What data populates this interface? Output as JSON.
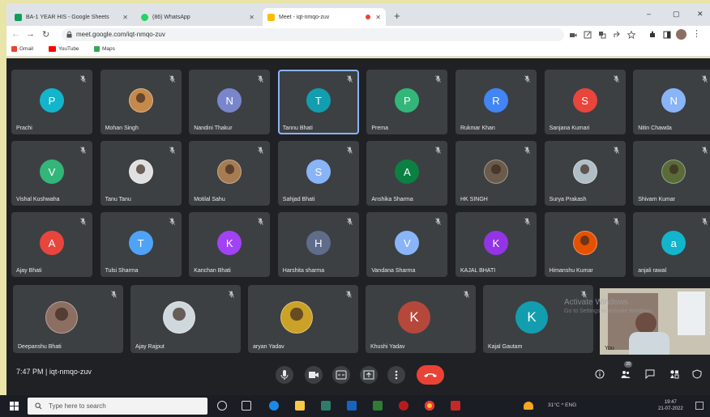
{
  "browser": {
    "tabs": [
      {
        "label": "BA-1 YEAR HIS - Google Sheets",
        "fav_color": "#0f9d58"
      },
      {
        "label": "(86) WhatsApp",
        "fav_color": "#25d366"
      },
      {
        "label": "Meet - iqt-nmqo-zuv",
        "fav_color": "#fbbc04"
      }
    ],
    "new_tab_label": "+",
    "url": "meet.google.com/iqt-nmqo-zuv",
    "bookmarks": [
      {
        "label": "Gmail",
        "color": "#ea4335"
      },
      {
        "label": "YouTube",
        "color": "#ff0000"
      },
      {
        "label": "Maps",
        "color": "#34a853"
      }
    ]
  },
  "meeting": {
    "participants": [
      {
        "name": "Prachi",
        "initial": "P",
        "color": "#12b5cb",
        "type": "letter"
      },
      {
        "name": "Mohan Singh",
        "initial": "",
        "color": "#c58a4b",
        "type": "photo"
      },
      {
        "name": "Nandini Thakur",
        "initial": "N",
        "color": "#7986cb",
        "type": "letter"
      },
      {
        "name": "Tannu Bhati",
        "initial": "T",
        "color": "#129eaf",
        "type": "letter",
        "selected": true
      },
      {
        "name": "Prema",
        "initial": "P",
        "color": "#33b679",
        "type": "letter"
      },
      {
        "name": "Rukmar Khan",
        "initial": "R",
        "color": "#4285f4",
        "type": "letter"
      },
      {
        "name": "Sanjana Kumari",
        "initial": "S",
        "color": "#e8453c",
        "type": "letter"
      },
      {
        "name": "Nitin Chawda",
        "initial": "N",
        "color": "#8ab4f8",
        "type": "letter"
      },
      {
        "name": "Vishal Kushwaha",
        "initial": "V",
        "color": "#33b679",
        "type": "letter"
      },
      {
        "name": "Tanu Tanu",
        "initial": "",
        "color": "#e0e0e0",
        "type": "photo"
      },
      {
        "name": "Motilal Sahu",
        "initial": "",
        "color": "#a67c52",
        "type": "photo"
      },
      {
        "name": "Sahjad Bhati",
        "initial": "S",
        "color": "#8ab4f8",
        "type": "letter"
      },
      {
        "name": "Anshika Sharma",
        "initial": "A",
        "color": "#0b8043",
        "type": "letter"
      },
      {
        "name": "HK SINGH",
        "initial": "",
        "color": "#6b5b4a",
        "type": "photo"
      },
      {
        "name": "Surya Prakash",
        "initial": "",
        "color": "#b0bec5",
        "type": "photo"
      },
      {
        "name": "Shivam Kumar",
        "initial": "",
        "color": "#5a6b3a",
        "type": "photo"
      },
      {
        "name": "Ajay Bhati",
        "initial": "A",
        "color": "#e8453c",
        "type": "letter"
      },
      {
        "name": "Tulsi Sharma",
        "initial": "T",
        "color": "#4fa3f7",
        "type": "letter"
      },
      {
        "name": "Kanchan Bhati",
        "initial": "K",
        "color": "#a142f4",
        "type": "letter"
      },
      {
        "name": "Harshita sharma",
        "initial": "H",
        "color": "#5f6c8a",
        "type": "letter"
      },
      {
        "name": "Vandana Sharma",
        "initial": "V",
        "color": "#8ab4f8",
        "type": "letter"
      },
      {
        "name": "KAJAL BHATI",
        "initial": "K",
        "color": "#9334e6",
        "type": "letter"
      },
      {
        "name": "Himanshu Kumar",
        "initial": "",
        "color": "#e65100",
        "type": "photo"
      },
      {
        "name": "anjali rawal",
        "initial": "a",
        "color": "#12b5cb",
        "type": "letter"
      },
      {
        "name": "Deepanshu Bhati",
        "initial": "",
        "color": "#8d6e63",
        "type": "photo"
      },
      {
        "name": "Ajay Rajput",
        "initial": "",
        "color": "#cfd8dc",
        "type": "photo"
      },
      {
        "name": "aryan Yadav",
        "initial": "",
        "color": "#c9a227",
        "type": "photo"
      },
      {
        "name": "Khushi Yadav",
        "initial": "K",
        "color": "#b5483a",
        "type": "letter"
      },
      {
        "name": "Kajal Gautam",
        "initial": "K",
        "color": "#129eaf",
        "type": "letter"
      }
    ],
    "self_label": "You",
    "time": "7:47 PM",
    "separator": "|",
    "code": "iqt-nmqo-zuv",
    "activate_title": "Activate Windows",
    "activate_sub": "Go to Settings to activate Windows."
  },
  "taskbar": {
    "search_placeholder": "Type here to search",
    "tray": "31°C  ^  ENG",
    "time": "19:47",
    "date": "21-07-2022"
  }
}
